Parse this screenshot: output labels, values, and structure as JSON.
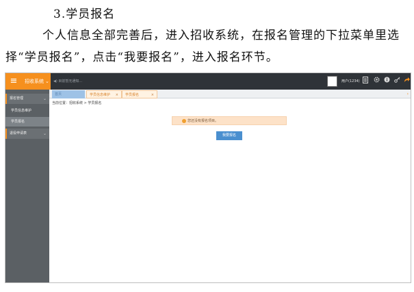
{
  "document": {
    "heading": "3.学员报名",
    "paragraph": "个人信息全部完善后，进入招收系统，在报名管理的下拉菜单里选择“学员报名”，点击“我要报名”，进入报名环节。"
  },
  "topbar": {
    "menu_icon": "≡",
    "system_label": "招收系统",
    "system_caret": "⌄",
    "notice_text": "◀) 目前暂无通知...",
    "user_label": "用户(1234)",
    "icons": [
      "document-icon",
      "gear-icon",
      "info-icon",
      "key-icon",
      "logout-icon"
    ]
  },
  "sidebar": {
    "group1": "报名管理",
    "items": [
      "学员信息维护",
      "学员报名"
    ],
    "group2": "退役申请表"
  },
  "tabs": {
    "home": "首页",
    "tab_a": "学员信息维护",
    "tab_b": "学员报名",
    "close": "×",
    "right_arrow": "›"
  },
  "breadcrumb": "当前位置：招收系统 > 学员报名",
  "alert_text": "您还没有报名项目。",
  "enroll_button": "我要报名",
  "colors": {
    "accent": "#f6901e",
    "topbar": "#2f3338",
    "sidebar": "#5b6064",
    "button": "#4a8fcf",
    "alert_bg": "#fde2c8"
  }
}
